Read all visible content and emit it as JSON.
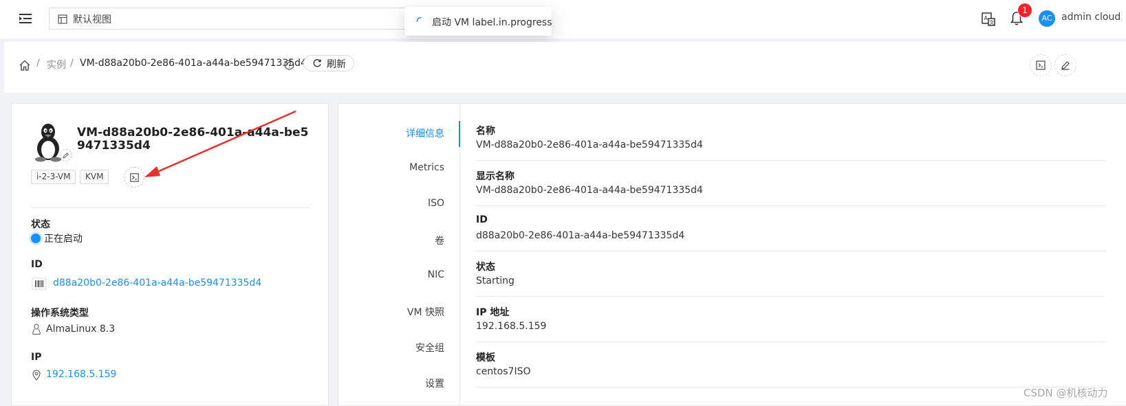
{
  "topbar": {
    "view_selector_label": "默认视图",
    "toast_text": "启动 VM label.in.progress",
    "notification_count": "1",
    "avatar_initials": "AC",
    "username": "admin cloud"
  },
  "breadcrumb": {
    "items": [
      "实例",
      "VM-d88a20b0-2e86-401a-a44a-be59471335d4"
    ],
    "separator": "/",
    "refresh_label": "刷新"
  },
  "summary": {
    "vm_name": "VM-d88a20b0-2e86-401a-a44a-be59471335d4",
    "tags": [
      "i-2-3-VM",
      "KVM"
    ],
    "fields": [
      {
        "label": "状态",
        "value": "正在启动"
      },
      {
        "label": "ID",
        "value": "d88a20b0-2e86-401a-a44a-be59471335d4"
      },
      {
        "label": "操作系统类型",
        "value": "AlmaLinux 8.3"
      },
      {
        "label": "IP",
        "value": "192.168.5.159"
      }
    ]
  },
  "tabs": [
    "详细信息",
    "Metrics",
    "ISO",
    "卷",
    "NIC",
    "VM 快照",
    "安全组",
    "设置"
  ],
  "active_tab": "详细信息",
  "details": [
    {
      "label": "名称",
      "value": "VM-d88a20b0-2e86-401a-a44a-be59471335d4"
    },
    {
      "label": "显示名称",
      "value": "VM-d88a20b0-2e86-401a-a44a-be59471335d4"
    },
    {
      "label": "ID",
      "value": "d88a20b0-2e86-401a-a44a-be59471335d4"
    },
    {
      "label": "状态",
      "value": "Starting"
    },
    {
      "label": "IP 地址",
      "value": "192.168.5.159"
    },
    {
      "label": "模板",
      "value": "centos7ISO"
    }
  ],
  "colors": {
    "primary": "#1890ff",
    "badge": "#f5222d",
    "annotation_arrow": "#e5322d"
  },
  "icons": [
    "menu-fold-icon",
    "layout-icon",
    "loading-icon",
    "translate-icon",
    "bell-icon",
    "home-icon",
    "question-circle-icon",
    "reload-icon",
    "code-icon",
    "edit-icon",
    "linux-icon",
    "barcode-icon",
    "environment-icon"
  ],
  "watermark": "CSDN @机核动力"
}
